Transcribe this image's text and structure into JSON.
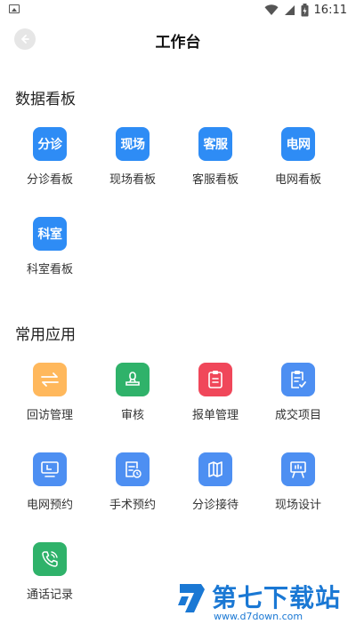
{
  "status_bar": {
    "time": "16:11",
    "icons": [
      "image-icon",
      "wifi-icon",
      "signal-icon",
      "battery-icon"
    ]
  },
  "header": {
    "title": "工作台",
    "back_icon": "back-arrow-icon"
  },
  "sections": [
    {
      "title": "数据看板",
      "items": [
        {
          "label": "分诊看板",
          "tile_text": "分诊",
          "color": "#2e8cf5"
        },
        {
          "label": "现场看板",
          "tile_text": "现场",
          "color": "#2e8cf5"
        },
        {
          "label": "客服看板",
          "tile_text": "客服",
          "color": "#2e8cf5"
        },
        {
          "label": "电网看板",
          "tile_text": "电网",
          "color": "#2e8cf5"
        },
        {
          "label": "科室看板",
          "tile_text": "科室",
          "color": "#2e8cf5"
        }
      ]
    },
    {
      "title": "常用应用",
      "items": [
        {
          "label": "回访管理",
          "icon": "swap-arrows-icon",
          "color": "#ffb85c"
        },
        {
          "label": "审核",
          "icon": "stamp-icon",
          "color": "#2fb26a"
        },
        {
          "label": "报单管理",
          "icon": "clipboard-icon",
          "color": "#f0475a"
        },
        {
          "label": "成交项目",
          "icon": "clipboard-check-icon",
          "color": "#4d8ff2"
        },
        {
          "label": "电网预约",
          "icon": "monitor-clock-icon",
          "color": "#4d8ff2"
        },
        {
          "label": "手术预约",
          "icon": "document-clock-icon",
          "color": "#4d8ff2"
        },
        {
          "label": "分诊接待",
          "icon": "map-icon",
          "color": "#4d8ff2"
        },
        {
          "label": "现场设计",
          "icon": "easel-icon",
          "color": "#4d8ff2"
        },
        {
          "label": "通话记录",
          "icon": "phone-icon",
          "color": "#2fb26a"
        }
      ]
    }
  ],
  "watermark": {
    "brand": "第七下载站",
    "url": "www.d7down.com"
  }
}
